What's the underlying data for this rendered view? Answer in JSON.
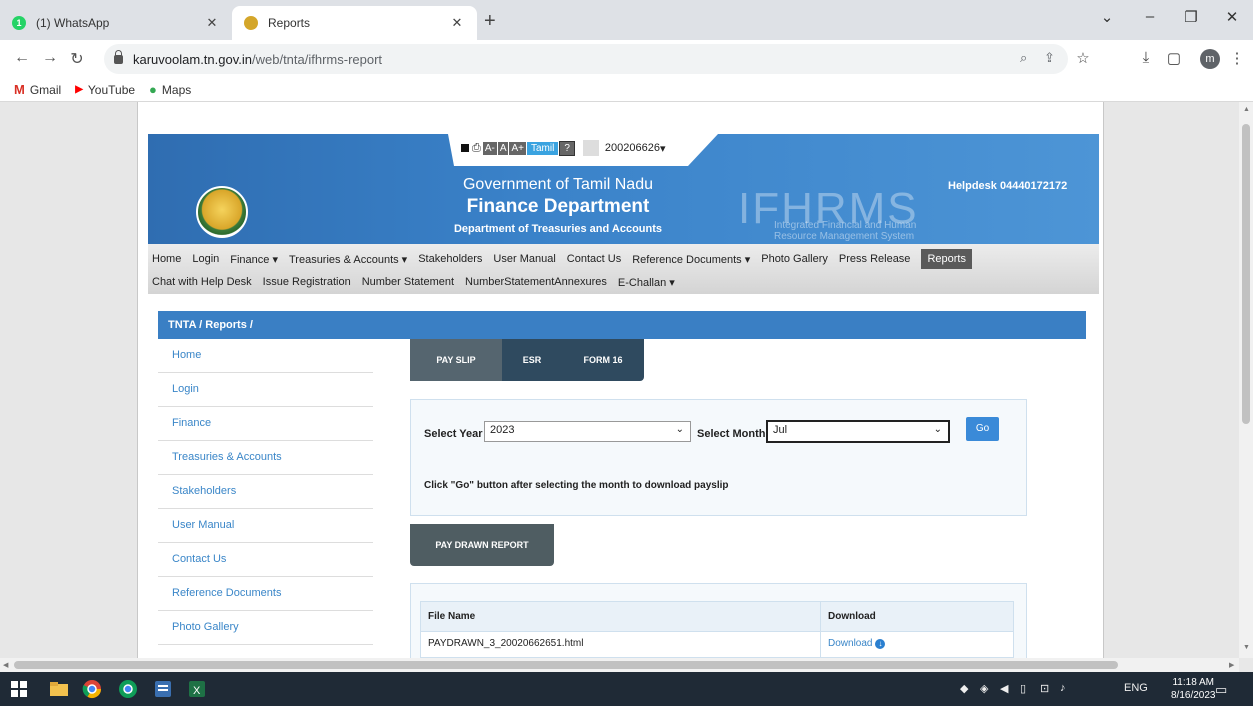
{
  "browser": {
    "tabs": [
      {
        "title": "(1) WhatsApp",
        "badge": "1",
        "active": false
      },
      {
        "title": "Reports",
        "active": true
      }
    ],
    "url_host": "karuvoolam.tn.gov.in",
    "url_path": "/web/tnta/ifhrms-report",
    "profile_initial": "m",
    "bookmarks": [
      {
        "label": "Gmail",
        "icon": "gmail-icon",
        "glyph": "M",
        "color": "#d93025"
      },
      {
        "label": "YouTube",
        "icon": "youtube-icon",
        "glyph": "▶",
        "color": "#ff0000"
      },
      {
        "label": "Maps",
        "icon": "maps-pin-icon",
        "glyph": "●",
        "color": "#34a853"
      }
    ]
  },
  "site": {
    "tools": {
      "a_minus": "A-",
      "a": "A",
      "a_plus": "A+",
      "language": "Tamil",
      "help": "?",
      "user_id": "200206626",
      "user_caret": "▾"
    },
    "header": {
      "line1": "Government of Tamil Nadu",
      "line2": "Finance Department",
      "line3": "Department of Treasuries and Accounts",
      "logo_text": "IFHRMS",
      "logo_sub1": "Integrated Financial and Human",
      "logo_sub2": "Resource Management System",
      "helpdesk": "Helpdesk  04440172172"
    },
    "menu_row1": [
      "Home",
      "Login",
      "Finance ▾",
      "Treasuries & Accounts ▾",
      "Stakeholders",
      "User Manual",
      "Contact Us",
      "Reference Documents ▾",
      "Photo Gallery",
      "Press Release",
      "Reports"
    ],
    "menu_row2": [
      "Chat with Help Desk",
      "Issue Registration",
      "Number Statement",
      "NumberStatementAnnexures",
      "E-Challan ▾"
    ],
    "breadcrumb": "TNTA / Reports /",
    "sidenav": [
      "Home",
      "Login",
      "Finance",
      "Treasuries & Accounts",
      "Stakeholders",
      "User Manual",
      "Contact Us",
      "Reference Documents",
      "Photo Gallery"
    ],
    "report_tabs": [
      "PAY SLIP",
      "ESR",
      "FORM 16"
    ],
    "form": {
      "year_label": "Select Year",
      "year_value": "2023",
      "month_label": "Select Month",
      "month_value": "Jul",
      "go_label": "Go",
      "hint": "Click \"Go\" button after selecting the month to download payslip"
    },
    "pay_drawn_label": "PAY DRAWN REPORT",
    "table": {
      "headers": [
        "File Name",
        "Download"
      ],
      "rows": [
        {
          "file": "PAYDRAWN_3_20020662651.html",
          "link": "Download"
        }
      ]
    }
  },
  "taskbar": {
    "lang": "ENG",
    "time": "11:18 AM",
    "date": "8/16/2023"
  }
}
